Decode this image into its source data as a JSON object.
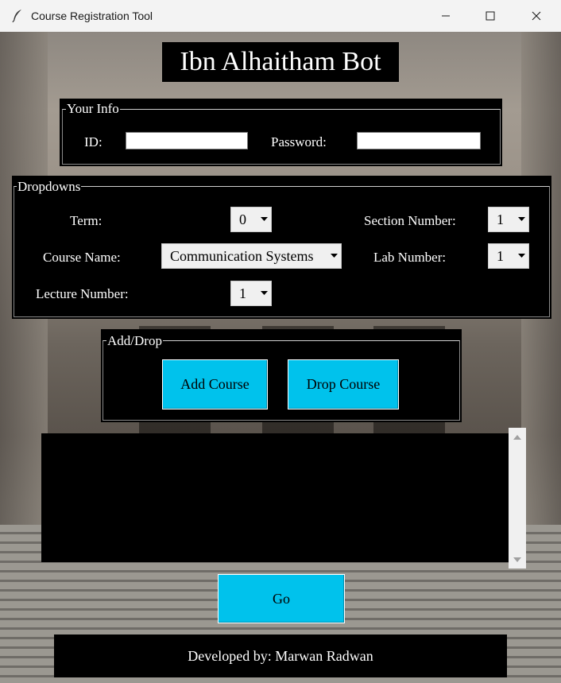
{
  "window": {
    "title": "Course Registration Tool",
    "icon": "feather-icon",
    "controls": [
      "minimize-icon",
      "maximize-icon",
      "close-icon"
    ]
  },
  "header": {
    "title": "Ibn Alhaitham Bot"
  },
  "your_info": {
    "legend": "Your Info",
    "id_label": "ID:",
    "id_value": "",
    "password_label": "Password:",
    "password_value": ""
  },
  "dropdowns": {
    "legend": "Dropdowns",
    "term_label": "Term:",
    "term_value": "0",
    "section_label": "Section Number:",
    "section_value": "1",
    "course_label": "Course Name:",
    "course_value": "Communication Systems",
    "lab_label": "Lab Number:",
    "lab_value": "1",
    "lecture_label": "Lecture Number:",
    "lecture_value": "1"
  },
  "add_drop": {
    "legend": "Add/Drop",
    "add_label": "Add Course",
    "drop_label": "Drop Course"
  },
  "output": {
    "text": ""
  },
  "go_label": "Go",
  "footer": {
    "text": "Developed by: Marwan Radwan"
  },
  "colors": {
    "button_bg": "#00c2ec",
    "panel_bg": "#000000",
    "text_on_panel": "#ffffff"
  }
}
